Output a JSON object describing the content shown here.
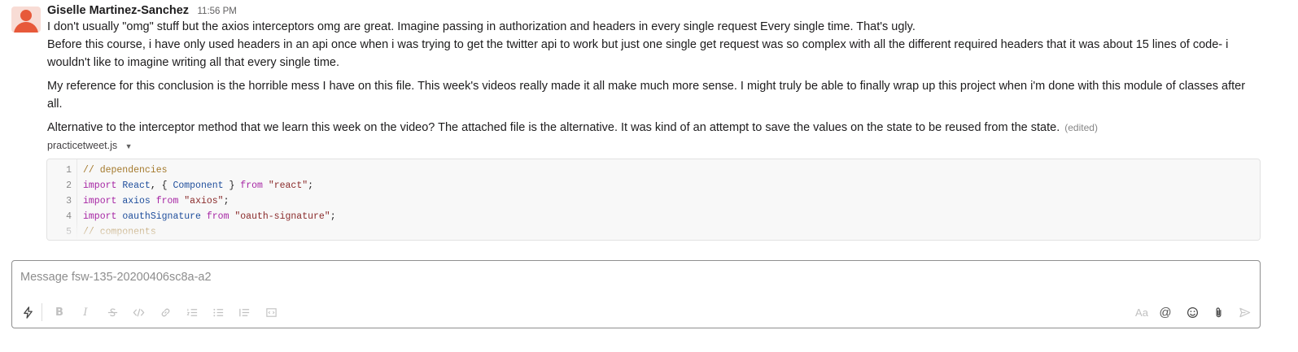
{
  "message": {
    "author": "Giselle Martinez-Sanchez",
    "timestamp": "11:56 PM",
    "paragraph1_line1": "I don't usually \"omg\" stuff but the axios interceptors omg are great. Imagine passing in authorization and headers in every single request Every single time. That's ugly.",
    "paragraph1_line2": "Before this course, i have only used headers in an api once when i was trying to get the twitter api to work but just one single get request was so complex with all the different required headers that it was about 15 lines of code- i wouldn't like to imagine writing all that every single time.",
    "paragraph2": "My reference for this conclusion is the horrible mess I have on this file. This week's videos really made it all make much more sense. I might truly be able to finally wrap up this project when i'm done with this module of classes after all.",
    "paragraph3": "Alternative to the interceptor method that we learn this week on the video? The attached file is the alternative. It was kind of an attempt to save the values on the state to be reused from the state.",
    "edited_label": "(edited)"
  },
  "attachment": {
    "file_name": "practicetweet.js",
    "caret_icon": "chevron-down-icon",
    "lines": [
      {
        "num": "1",
        "tokens": [
          {
            "t": "// dependencies",
            "k": "comment"
          }
        ]
      },
      {
        "num": "2",
        "tokens": [
          {
            "t": "import",
            "k": "keyword"
          },
          {
            "t": " ",
            "k": "plain"
          },
          {
            "t": "React",
            "k": "ident"
          },
          {
            "t": ", { ",
            "k": "plain"
          },
          {
            "t": "Component",
            "k": "ident"
          },
          {
            "t": " } ",
            "k": "plain"
          },
          {
            "t": "from",
            "k": "keyword"
          },
          {
            "t": " ",
            "k": "plain"
          },
          {
            "t": "\"react\"",
            "k": "string"
          },
          {
            "t": ";",
            "k": "plain"
          }
        ]
      },
      {
        "num": "3",
        "tokens": [
          {
            "t": "import",
            "k": "keyword"
          },
          {
            "t": " ",
            "k": "plain"
          },
          {
            "t": "axios",
            "k": "ident"
          },
          {
            "t": " ",
            "k": "plain"
          },
          {
            "t": "from",
            "k": "keyword"
          },
          {
            "t": " ",
            "k": "plain"
          },
          {
            "t": "\"axios\"",
            "k": "string"
          },
          {
            "t": ";",
            "k": "plain"
          }
        ]
      },
      {
        "num": "4",
        "tokens": [
          {
            "t": "import",
            "k": "keyword"
          },
          {
            "t": " ",
            "k": "plain"
          },
          {
            "t": "oauthSignature",
            "k": "ident"
          },
          {
            "t": " ",
            "k": "plain"
          },
          {
            "t": "from",
            "k": "keyword"
          },
          {
            "t": " ",
            "k": "plain"
          },
          {
            "t": "\"oauth-signature\"",
            "k": "string"
          },
          {
            "t": ";",
            "k": "plain"
          }
        ]
      },
      {
        "num": "5",
        "tokens": [
          {
            "t": "// components",
            "k": "comment"
          }
        ]
      }
    ]
  },
  "composer": {
    "placeholder": "Message fsw-135-20200406sc8a-a2",
    "value": "",
    "format_aa_label": "Aa",
    "mention_label": "@"
  },
  "icons": {
    "shortcuts": "lightning-icon",
    "bold": "bold-icon",
    "italic": "italic-icon",
    "strikethrough": "strikethrough-icon",
    "code": "code-icon",
    "link": "link-icon",
    "ordered_list": "ordered-list-icon",
    "bulleted_list": "bulleted-list-icon",
    "blockquote": "blockquote-icon",
    "code_block": "code-block-icon",
    "emoji": "emoji-icon",
    "attach": "paperclip-icon",
    "send": "send-icon"
  },
  "colors": {
    "avatar_bg": "#f8dcd5",
    "avatar_fg": "#e7593a",
    "comment": "#a4792c",
    "keyword": "#a626a4",
    "identifier": "#1f4e9c",
    "string": "#8a2b2b"
  }
}
